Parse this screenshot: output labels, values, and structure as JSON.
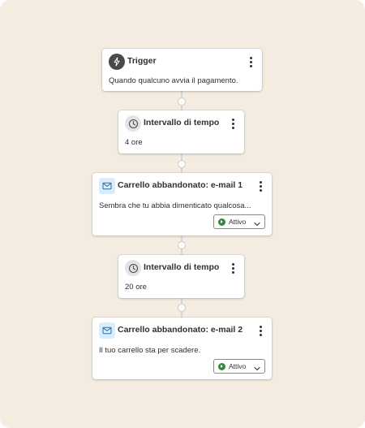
{
  "workflow": {
    "steps": [
      {
        "title": "Trigger",
        "text": "Quando qualcuno avvia il pagamento.",
        "icon": "lightning-icon"
      },
      {
        "title": "Intervallo di tempo",
        "text": "4 ore",
        "icon": "clock-icon"
      },
      {
        "title": "Carrello abbandonato: e-mail 1",
        "text": "Sembra che tu abbia dimenticato qualcosa...",
        "icon": "mail-icon",
        "status": "Attivo"
      },
      {
        "title": "Intervallo di tempo",
        "text": "20 ore",
        "icon": "clock-icon"
      },
      {
        "title": "Carrello abbandonato: e-mail 2",
        "text": "Il tuo carrello sta per scadere.",
        "icon": "mail-icon",
        "status": "Attivo"
      }
    ]
  },
  "colors": {
    "background": "#f4ece0",
    "status_active": "#2f8a3a",
    "mail_icon_bg": "#d9edfb"
  }
}
